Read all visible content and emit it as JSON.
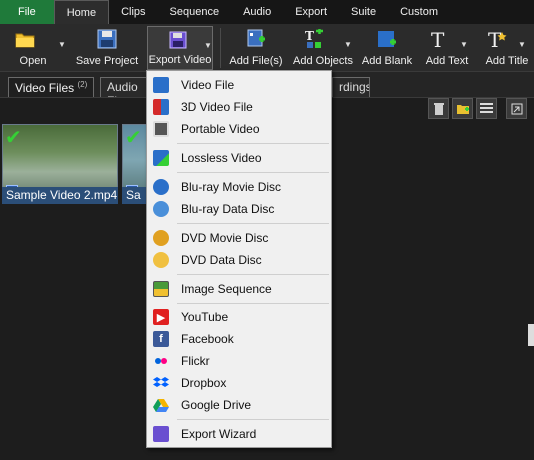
{
  "menu_tabs": [
    "File",
    "Home",
    "Clips",
    "Sequence",
    "Audio",
    "Export",
    "Suite",
    "Custom"
  ],
  "ribbon": {
    "open": "Open",
    "save_project": "Save Project",
    "export_video": "Export Video",
    "add_files": "Add File(s)",
    "add_objects": "Add Objects",
    "add_blank": "Add Blank",
    "add_text": "Add Text",
    "add_title": "Add Title"
  },
  "panel": {
    "video_files": "Video Files",
    "video_files_count": "(2)",
    "audio_files": "Audio Fi",
    "recordings": "rdings"
  },
  "clips": [
    {
      "label": "Sample Video 2.mp4"
    },
    {
      "label": "Sa"
    }
  ],
  "export_menu": {
    "items": [
      {
        "label": "Video File",
        "icon": "video-file-icon"
      },
      {
        "label": "3D Video File",
        "icon": "3d-video-file-icon"
      },
      {
        "label": "Portable Video",
        "icon": "portable-video-icon"
      },
      {
        "label": "Lossless Video",
        "icon": "lossless-video-icon"
      },
      {
        "label": "Blu-ray Movie Disc",
        "icon": "bluray-movie-disc-icon"
      },
      {
        "label": "Blu-ray Data Disc",
        "icon": "bluray-data-disc-icon"
      },
      {
        "label": "DVD Movie Disc",
        "icon": "dvd-movie-disc-icon"
      },
      {
        "label": "DVD Data Disc",
        "icon": "dvd-data-disc-icon"
      },
      {
        "label": "Image Sequence",
        "icon": "image-sequence-icon"
      },
      {
        "label": "YouTube",
        "icon": "youtube-icon"
      },
      {
        "label": "Facebook",
        "icon": "facebook-icon"
      },
      {
        "label": "Flickr",
        "icon": "flickr-icon"
      },
      {
        "label": "Dropbox",
        "icon": "dropbox-icon"
      },
      {
        "label": "Google Drive",
        "icon": "google-drive-icon"
      },
      {
        "label": "Export Wizard",
        "icon": "export-wizard-icon"
      }
    ]
  },
  "colors": {
    "file_tab": "#1f7a3a",
    "selection": "#2b4e78",
    "menu_bg": "#f0f0f0"
  }
}
